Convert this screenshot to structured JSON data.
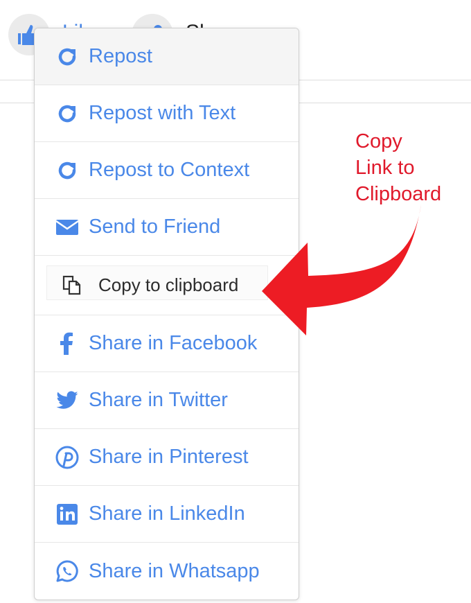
{
  "background": {
    "like_label": "Like",
    "share_label": "Share"
  },
  "menu": {
    "items": [
      {
        "label": "Repost",
        "icon": "repost-icon"
      },
      {
        "label": "Repost with Text",
        "icon": "repost-icon"
      },
      {
        "label": "Repost to Context",
        "icon": "repost-icon"
      },
      {
        "label": "Send to Friend",
        "icon": "envelope-icon"
      },
      {
        "label": "Copy to clipboard",
        "icon": "copy-icon"
      },
      {
        "label": "Share in Facebook",
        "icon": "facebook-icon"
      },
      {
        "label": "Share in Twitter",
        "icon": "twitter-icon"
      },
      {
        "label": "Share in Pinterest",
        "icon": "pinterest-icon"
      },
      {
        "label": "Share in LinkedIn",
        "icon": "linkedin-icon"
      },
      {
        "label": "Share in Whatsapp",
        "icon": "whatsapp-icon"
      }
    ]
  },
  "annotation": {
    "lines": [
      "Copy",
      "Link to",
      "Clipboard"
    ]
  },
  "colors": {
    "link_blue": "#4a88e8",
    "annotation_red": "#e0192b"
  }
}
